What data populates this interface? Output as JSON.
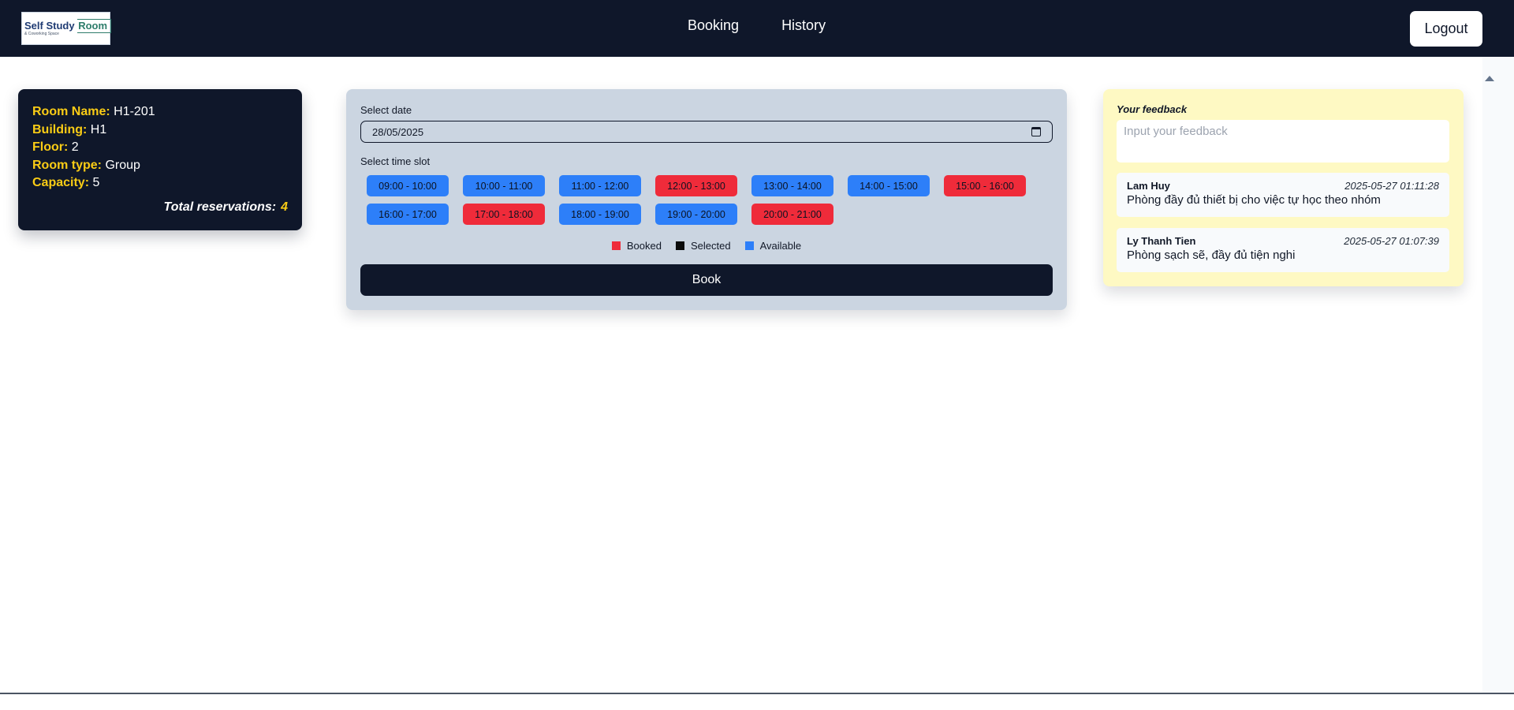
{
  "header": {
    "logo": {
      "line1_a": "Self Study ",
      "line1_b": "Room",
      "line2": "& Coworking Space"
    },
    "nav": [
      {
        "label": "Booking"
      },
      {
        "label": "History"
      }
    ],
    "logout_label": "Logout"
  },
  "room": {
    "fields": [
      {
        "key": "Room Name:",
        "value": "H1-201"
      },
      {
        "key": "Building:",
        "value": "H1"
      },
      {
        "key": "Floor:",
        "value": "2"
      },
      {
        "key": "Room type:",
        "value": "Group"
      },
      {
        "key": "Capacity:",
        "value": "5"
      }
    ],
    "total_label": "Total reservations:",
    "total_value": "4"
  },
  "booking": {
    "date_label": "Select date",
    "date_value": "28/05/2025",
    "time_label": "Select time slot",
    "slots": [
      {
        "label": "09:00 - 10:00",
        "status": "available"
      },
      {
        "label": "10:00 - 11:00",
        "status": "available"
      },
      {
        "label": "11:00 - 12:00",
        "status": "available"
      },
      {
        "label": "12:00 - 13:00",
        "status": "booked"
      },
      {
        "label": "13:00 - 14:00",
        "status": "available"
      },
      {
        "label": "14:00 - 15:00",
        "status": "available"
      },
      {
        "label": "15:00 - 16:00",
        "status": "booked"
      },
      {
        "label": "16:00 - 17:00",
        "status": "available"
      },
      {
        "label": "17:00 - 18:00",
        "status": "booked"
      },
      {
        "label": "18:00 - 19:00",
        "status": "available"
      },
      {
        "label": "19:00 - 20:00",
        "status": "available"
      },
      {
        "label": "20:00 - 21:00",
        "status": "booked"
      }
    ],
    "legend": [
      {
        "label": "Booked",
        "color": "#ef2b3a"
      },
      {
        "label": "Selected",
        "color": "#0b0b0b"
      },
      {
        "label": "Available",
        "color": "#2d7ff9"
      }
    ],
    "book_label": "Book"
  },
  "feedback": {
    "title": "Your feedback",
    "input_placeholder": "Input your feedback",
    "input_value": "",
    "items": [
      {
        "user": "Lam Huy",
        "time": "2025-05-27 01:11:28",
        "text": "Phòng đầy đủ thiết bị cho việc tự học theo nhóm"
      },
      {
        "user": "Ly Thanh Tien",
        "time": "2025-05-27 01:07:39",
        "text": "Phòng sạch sẽ, đầy đủ tiện nghi"
      }
    ]
  },
  "colors": {
    "nav_bg": "#0f172a",
    "booked": "#ef2b3a",
    "available": "#2d7ff9",
    "selected": "#0b0b0b",
    "highlight": "#facc15",
    "booking_panel": "#cbd5e1",
    "feedback_panel": "#fef9c3"
  }
}
